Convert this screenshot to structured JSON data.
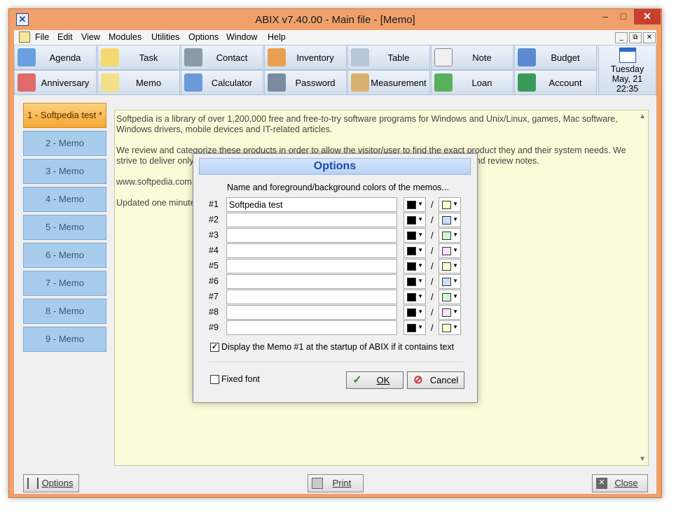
{
  "window": {
    "title": "ABIX v7.40.00  -  Main file - [Memo]",
    "min_label": "–",
    "max_label": "□",
    "close_label": "✕"
  },
  "menu": {
    "items": [
      "File",
      "Edit",
      "View",
      "Modules",
      "Utilities",
      "Options",
      "Window",
      "Help"
    ],
    "mdi": [
      "_",
      "⧉",
      "✕"
    ]
  },
  "toolbar": {
    "row1": [
      "Agenda",
      "Task",
      "Contact",
      "Inventory",
      "Table",
      "Note",
      "Budget"
    ],
    "row2": [
      "Anniversary",
      "Memo",
      "Calculator",
      "Password",
      "Measurement",
      "Loan",
      "Account"
    ],
    "date": {
      "day": "Tuesday",
      "date": "May, 21",
      "time": "22:35"
    }
  },
  "tabs": [
    {
      "label": "1 - Softpedia test *",
      "active": true
    },
    {
      "label": "2 - Memo",
      "active": false
    },
    {
      "label": "3 - Memo",
      "active": false
    },
    {
      "label": "4 - Memo",
      "active": false
    },
    {
      "label": "5 - Memo",
      "active": false
    },
    {
      "label": "6 - Memo",
      "active": false
    },
    {
      "label": "7 - Memo",
      "active": false
    },
    {
      "label": "8 - Memo",
      "active": false
    },
    {
      "label": "9 - Memo",
      "active": false
    }
  ],
  "memo": {
    "paragraphs": [
      "Softpedia is a library of over 1,200,000 free and free-to-try software programs for Windows and Unix/Linux, games, Mac software, Windows drivers, mobile devices and IT-related articles.",
      "We review and categorize these products in order to allow the visitor/user to find the exact product they and their system needs. We strive to deliver only the best products to the visitor/user together with self-made evaluation and review notes.",
      "www.softpedia.com",
      "Updated one minute ago"
    ]
  },
  "buttons": {
    "options": "Options",
    "print": "Print",
    "close": "Close"
  },
  "dialog": {
    "title": "Options",
    "header": "Name and foreground/background colors of the memos...",
    "rows": [
      {
        "num": "#1",
        "name": "Softpedia test",
        "fg": "#000000",
        "bg": "#ffffd0"
      },
      {
        "num": "#2",
        "name": "",
        "fg": "#000000",
        "bg": "#c8e0fc"
      },
      {
        "num": "#3",
        "name": "",
        "fg": "#000000",
        "bg": "#d0f8d0"
      },
      {
        "num": "#4",
        "name": "",
        "fg": "#000000",
        "bg": "#fce0fc"
      },
      {
        "num": "#5",
        "name": "",
        "fg": "#000000",
        "bg": "#ffffd0"
      },
      {
        "num": "#6",
        "name": "",
        "fg": "#000000",
        "bg": "#c8e0fc"
      },
      {
        "num": "#7",
        "name": "",
        "fg": "#000000",
        "bg": "#d0f8d0"
      },
      {
        "num": "#8",
        "name": "",
        "fg": "#000000",
        "bg": "#fce0fc"
      },
      {
        "num": "#9",
        "name": "",
        "fg": "#000000",
        "bg": "#ffffd0"
      }
    ],
    "slash": "/",
    "startup_label": "Display the Memo #1 at the startup of ABIX if it contains text",
    "startup_checked": true,
    "fixed_font_label": "Fixed font",
    "fixed_font_checked": false,
    "ok_label": "OK",
    "cancel_label": "Cancel"
  },
  "colors": {
    "title_bar": "#f0a06b",
    "close_red": "#c7402f",
    "memo_bg": "#fbfbd9",
    "tab_blue": "#a8ccec",
    "tab_active": "#f5a733"
  }
}
